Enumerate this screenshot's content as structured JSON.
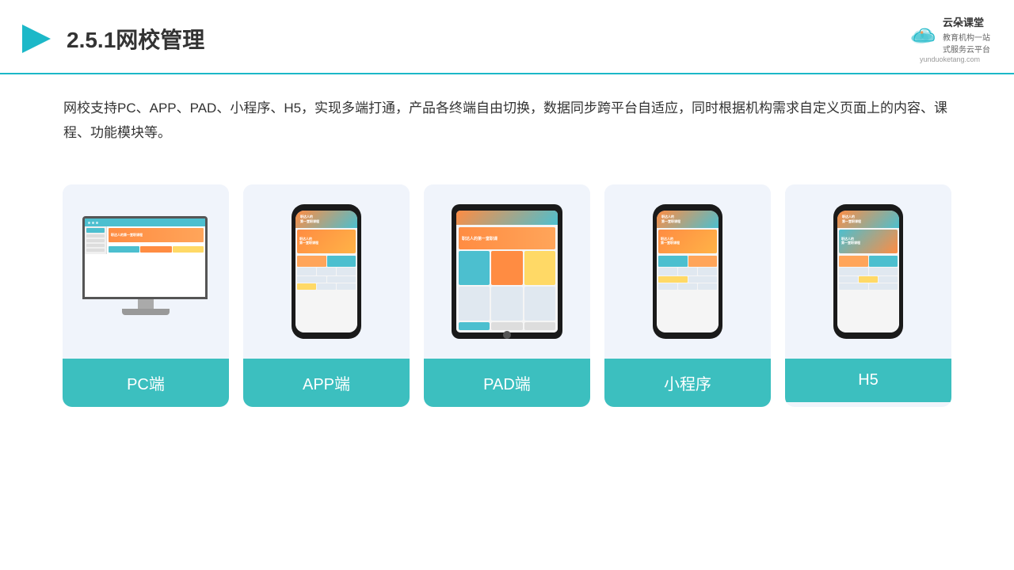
{
  "header": {
    "title": "2.5.1网校管理",
    "logo": {
      "name": "云朵课堂",
      "url": "yunduoketang.com",
      "tagline": "教育机构一站\n式服务云平台"
    }
  },
  "description": {
    "text": "网校支持PC、APP、PAD、小程序、H5，实现多端打通，产品各终端自由切换，数据同步跨平台自适应，同时根据机构需求自定义页面上的内容、课程、功能模块等。"
  },
  "cards": [
    {
      "id": "pc",
      "label": "PC端"
    },
    {
      "id": "app",
      "label": "APP端"
    },
    {
      "id": "pad",
      "label": "PAD端"
    },
    {
      "id": "miniapp",
      "label": "小程序"
    },
    {
      "id": "h5",
      "label": "H5"
    }
  ],
  "colors": {
    "accent": "#3cbfbf",
    "headerBorder": "#1cb8c8",
    "cardBg": "#f0f4fb"
  }
}
